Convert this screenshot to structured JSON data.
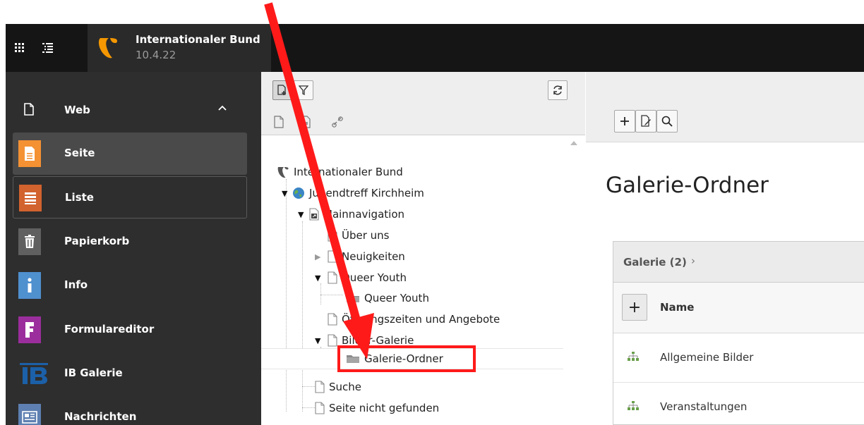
{
  "topbar": {
    "site_name": "Internationaler Bund",
    "version": "10.4.22",
    "grid_icon": "app-grid-icon",
    "tree_icon": "list-tree-icon",
    "logo": "typo3-logo"
  },
  "module_menu": {
    "group": {
      "label": "Web",
      "icon": "page-outline-icon",
      "toggle_icon": "chevron-up-icon"
    },
    "modules": [
      {
        "label": "Seite",
        "icon": "page-module-icon",
        "color": "#f49133",
        "state": "active"
      },
      {
        "label": "Liste",
        "icon": "list-module-icon",
        "color": "#d2622e",
        "state": "outlined"
      },
      {
        "label": "Papierkorb",
        "icon": "trash-icon",
        "color": "#606060",
        "state": "normal"
      },
      {
        "label": "Info",
        "icon": "info-icon",
        "color": "#4f90cf",
        "state": "normal"
      },
      {
        "label": "Formulareditor",
        "icon": "form-editor-icon",
        "color": "#9b2e9c",
        "state": "normal"
      },
      {
        "label": "IB Galerie",
        "icon": "ib-logo-icon",
        "color": "#1b60a8",
        "state": "normal"
      },
      {
        "label": "Nachrichten",
        "icon": "news-icon",
        "color": "#5e7fb1",
        "state": "normal"
      }
    ]
  },
  "page_tree": {
    "toolbar": {
      "new_page_icon": "new-page-icon",
      "filter_icon": "filter-icon",
      "refresh_icon": "refresh-icon",
      "doktype_page_icon": "page-type-icon",
      "doktype_folder_icon": "folder-type-icon",
      "doktype_link_icon": "link-type-icon"
    },
    "root": "Internationaler Bund",
    "nodes": [
      {
        "label": "Jugendtreff Kirchheim",
        "icon": "globe-site-icon"
      },
      {
        "label": "Mainnavigation",
        "icon": "shortcut-page-icon"
      },
      {
        "label": "Über uns",
        "icon": "page-icon"
      },
      {
        "label": "Neuigkeiten",
        "icon": "page-icon"
      },
      {
        "label": "Queer Youth",
        "icon": "page-icon"
      },
      {
        "label": "Queer Youth",
        "icon": "folder-icon"
      },
      {
        "label": "Öffnungszeiten und Angebote",
        "icon": "page-icon"
      },
      {
        "label": "Bilder-Galerie",
        "icon": "page-icon"
      },
      {
        "label": "Galerie-Ordner",
        "icon": "folder-icon",
        "selected": true
      },
      {
        "label": "Suche",
        "icon": "page-icon"
      },
      {
        "label": "Seite nicht gefunden",
        "icon": "page-icon"
      }
    ]
  },
  "content": {
    "toolbar": {
      "add_icon": "plus-icon",
      "edit_icon": "edit-page-icon",
      "search_icon": "search-icon"
    },
    "page_title": "Galerie-Ordner",
    "panel": {
      "title": "Galerie (2)",
      "column_add": "+",
      "column_name": "Name",
      "rows": [
        {
          "label": "Allgemeine Bilder",
          "icon": "sitemap-icon"
        },
        {
          "label": "Veranstaltungen",
          "icon": "sitemap-icon"
        }
      ]
    }
  },
  "annotation": {
    "arrow_color": "#ff1a1a",
    "box_color": "#ff1a1a"
  }
}
